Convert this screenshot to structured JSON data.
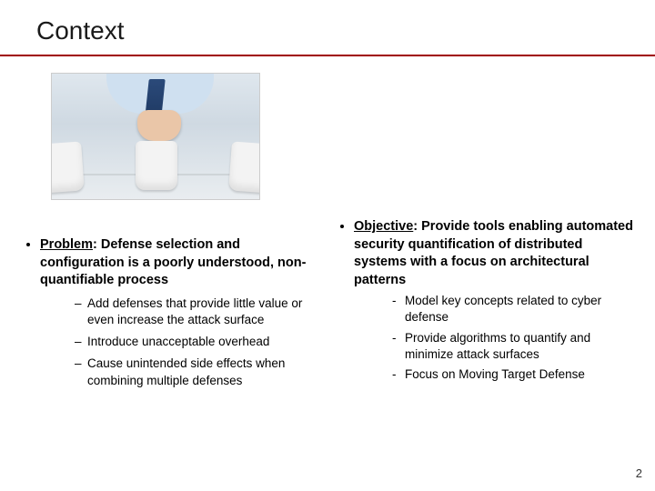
{
  "title": "Context",
  "image_alt": "Person in shirt and tie performing shell game with three cups",
  "left": {
    "problem_label": "Problem",
    "problem_rest": ": Defense selection and configuration is a poorly understood, non-quantifiable process",
    "sub": [
      "Add defenses that provide little value or even increase the attack surface",
      "Introduce unacceptable overhead",
      "Cause unintended side effects when combining multiple defenses"
    ]
  },
  "right": {
    "objective_label": "Objective",
    "objective_rest": ": Provide tools enabling automated security quantification of distributed systems with a focus on architectural patterns",
    "sub": [
      "Model key concepts related to cyber defense",
      "Provide algorithms to quantify and minimize attack surfaces",
      "Focus on Moving Target Defense"
    ]
  },
  "page_number": "2"
}
